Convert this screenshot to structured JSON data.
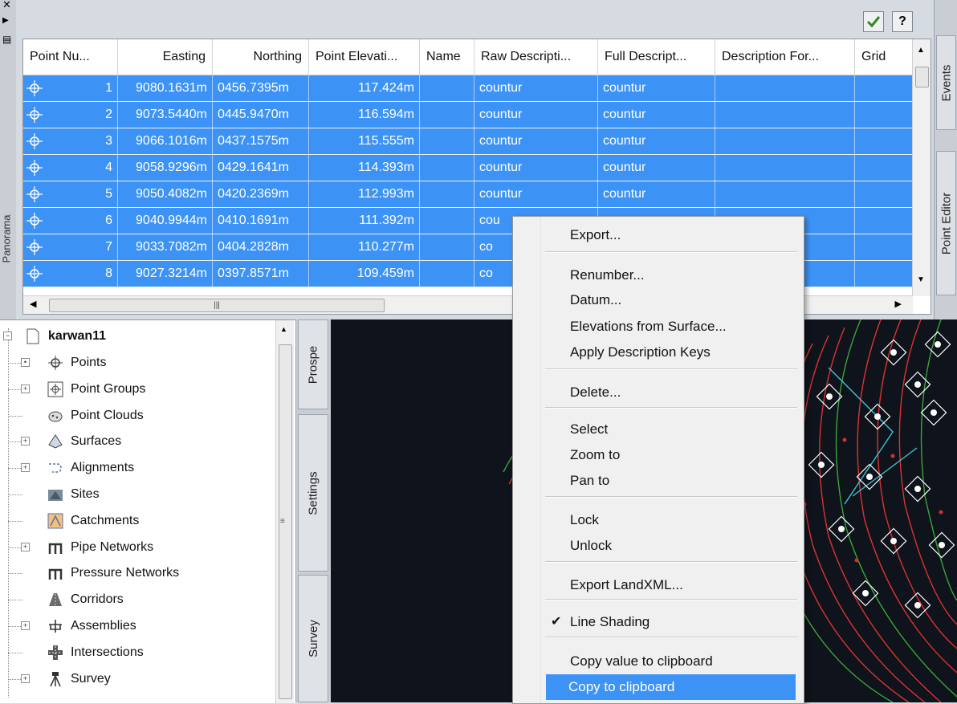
{
  "left_strip": {
    "vertical_label": "Panorama"
  },
  "toolbar": {
    "check_icon": "check-icon",
    "help_label": "?"
  },
  "grid": {
    "columns": [
      "Point Nu...",
      "Easting",
      "Northing",
      "Point Elevati...",
      "Name",
      "Raw Descripti...",
      "Full Descript...",
      "Description For...",
      "Grid"
    ],
    "rows": [
      {
        "num": "1",
        "easting": "9080.1631m",
        "northing": "0456.7395m",
        "elev": "117.424m",
        "name": "",
        "raw": "countur",
        "full": "countur",
        "fmt": ""
      },
      {
        "num": "2",
        "easting": "9073.5440m",
        "northing": "0445.9470m",
        "elev": "116.594m",
        "name": "",
        "raw": "countur",
        "full": "countur",
        "fmt": ""
      },
      {
        "num": "3",
        "easting": "9066.1016m",
        "northing": "0437.1575m",
        "elev": "115.555m",
        "name": "",
        "raw": "countur",
        "full": "countur",
        "fmt": ""
      },
      {
        "num": "4",
        "easting": "9058.9296m",
        "northing": "0429.1641m",
        "elev": "114.393m",
        "name": "",
        "raw": "countur",
        "full": "countur",
        "fmt": ""
      },
      {
        "num": "5",
        "easting": "9050.4082m",
        "northing": "0420.2369m",
        "elev": "112.993m",
        "name": "",
        "raw": "countur",
        "full": "countur",
        "fmt": ""
      },
      {
        "num": "6",
        "easting": "9040.9944m",
        "northing": "0410.1691m",
        "elev": "111.392m",
        "name": "",
        "raw": "cou",
        "full": "",
        "fmt": ""
      },
      {
        "num": "7",
        "easting": "9033.7082m",
        "northing": "0404.2828m",
        "elev": "110.277m",
        "name": "",
        "raw": "co",
        "full": "",
        "fmt": ""
      },
      {
        "num": "8",
        "easting": "9027.3214m",
        "northing": "0397.8571m",
        "elev": "109.459m",
        "name": "",
        "raw": "co",
        "full": "",
        "fmt": ""
      }
    ]
  },
  "side_tabs": [
    "Events",
    "Point Editor"
  ],
  "tree": {
    "root": "karwan11",
    "items": [
      {
        "label": "Points",
        "icon": "point-icon"
      },
      {
        "label": "Point Groups",
        "icon": "point-group-icon"
      },
      {
        "label": "Point Clouds",
        "icon": "point-cloud-icon"
      },
      {
        "label": "Surfaces",
        "icon": "surface-icon"
      },
      {
        "label": "Alignments",
        "icon": "alignment-icon"
      },
      {
        "label": "Sites",
        "icon": "site-icon"
      },
      {
        "label": "Catchments",
        "icon": "catchment-icon"
      },
      {
        "label": "Pipe Networks",
        "icon": "pipe-network-icon"
      },
      {
        "label": "Pressure Networks",
        "icon": "pressure-network-icon"
      },
      {
        "label": "Corridors",
        "icon": "corridor-icon"
      },
      {
        "label": "Assemblies",
        "icon": "assembly-icon"
      },
      {
        "label": "Intersections",
        "icon": "intersection-icon"
      },
      {
        "label": "Survey",
        "icon": "survey-icon"
      }
    ]
  },
  "toolspace_tabs": [
    "Prospe",
    "Settings",
    "Survey"
  ],
  "context_menu": {
    "items": [
      "Export...",
      "Renumber...",
      "Datum...",
      "Elevations from Surface...",
      "Apply Description Keys",
      "Delete...",
      "Select",
      "Zoom to",
      "Pan to",
      "Lock",
      "Unlock",
      "Export LandXML...",
      "Line Shading",
      "Copy value to clipboard",
      "Copy to clipboard"
    ],
    "highlighted": "Copy to clipboard",
    "checked": "Line Shading"
  }
}
